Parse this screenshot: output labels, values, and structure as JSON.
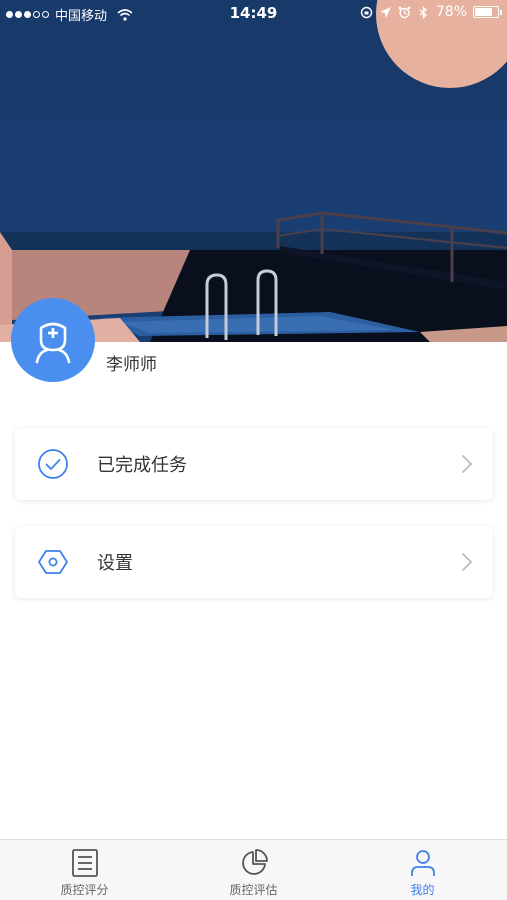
{
  "status_bar": {
    "carrier": "中国移动",
    "time": "14:49",
    "battery": "78%",
    "battery_level": 0.78,
    "signal_bars": 3,
    "signal_total": 5
  },
  "profile": {
    "name": "李师师"
  },
  "menu": {
    "items": [
      {
        "label": "已完成任务",
        "icon": "check-circle-icon"
      },
      {
        "label": "设置",
        "icon": "hexagon-settings-icon"
      }
    ]
  },
  "tab_bar": {
    "tabs": [
      {
        "label": "质控评分",
        "icon": "document-list-icon",
        "active": false
      },
      {
        "label": "质控评估",
        "icon": "pie-chart-icon",
        "active": false
      },
      {
        "label": "我的",
        "icon": "person-icon",
        "active": true
      }
    ]
  },
  "colors": {
    "accent": "#3d82ea",
    "avatar_bg": "#4a8ff0",
    "hero_sky": "#1a3d72",
    "moon": "#e7b1a0"
  }
}
